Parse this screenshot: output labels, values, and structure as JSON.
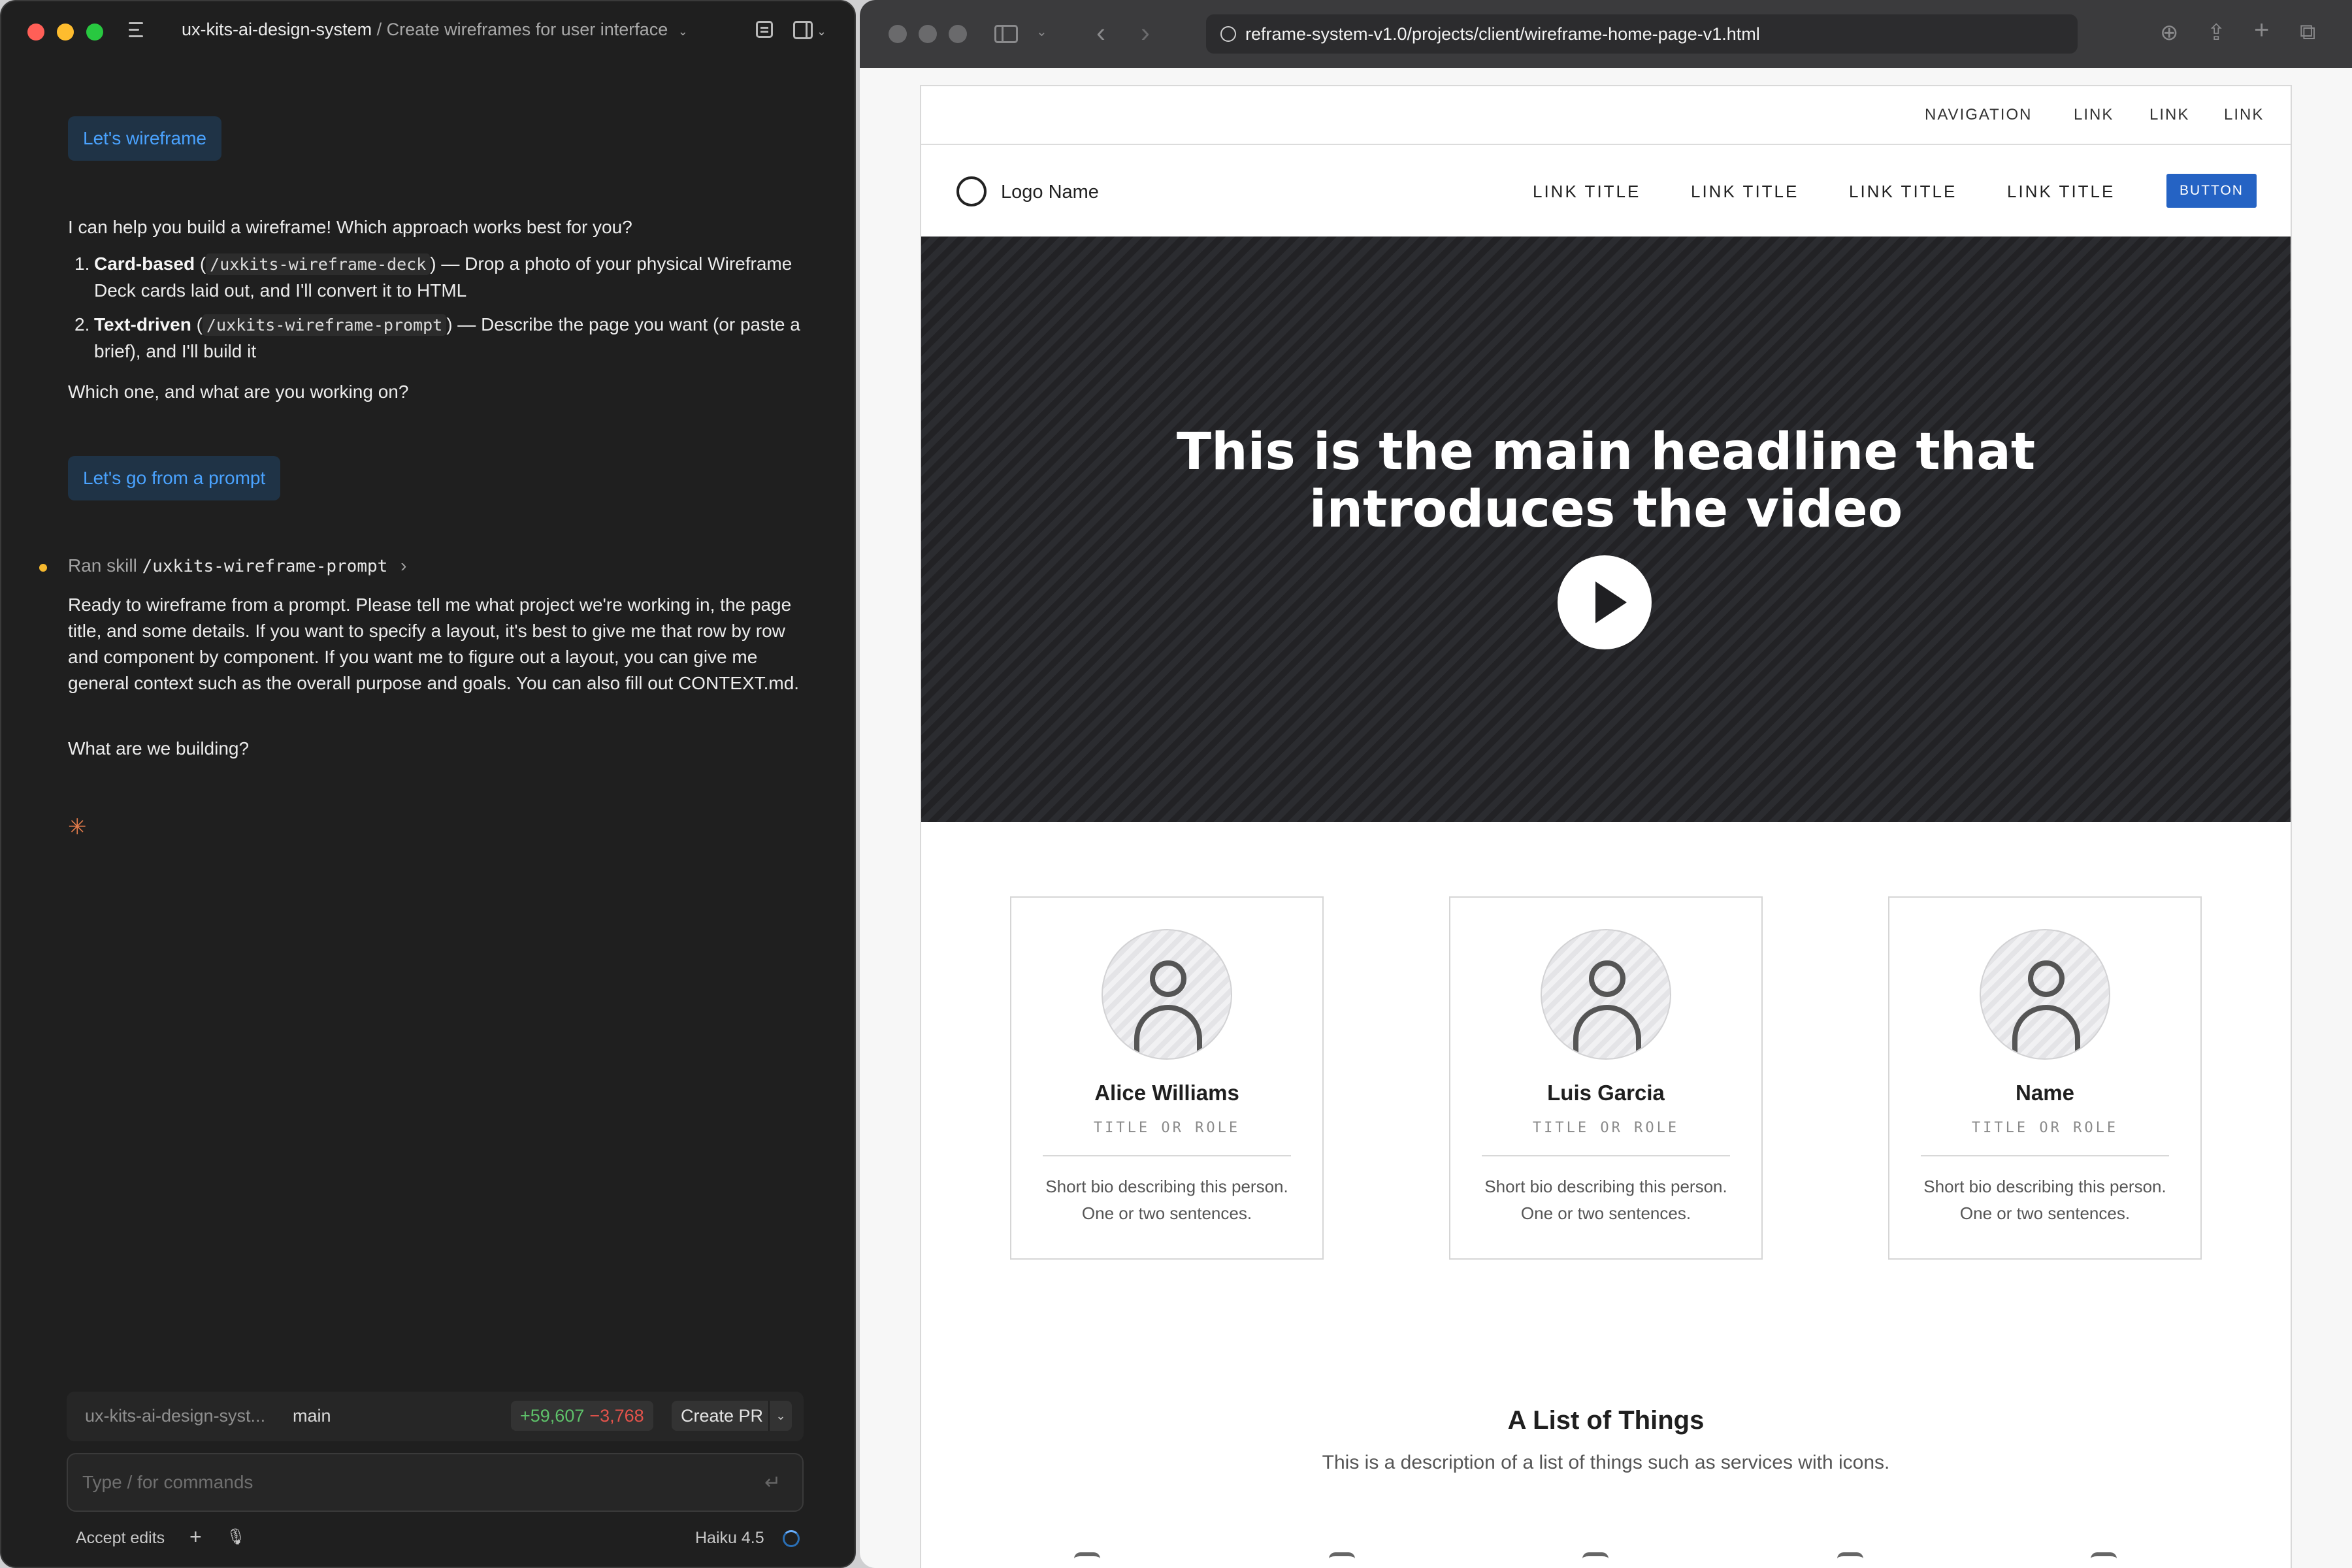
{
  "chat": {
    "project": "ux-kits-ai-design-system",
    "separator": "/",
    "conversation_title": "Create wireframes for user interface",
    "user_msg_1": "Let's wireframe",
    "assistant_intro": "I can help you build a wireframe! Which approach works best for you?",
    "options": [
      {
        "num": "1.",
        "title": "Card-based",
        "open": " (",
        "command": "/uxkits-wireframe-deck",
        "close": ")",
        "desc": " — Drop a photo of your physical Wireframe Deck cards laid out, and I'll convert it to HTML"
      },
      {
        "num": "2.",
        "title": "Text-driven",
        "open": " (",
        "command": "/uxkits-wireframe-prompt",
        "close": ")",
        "desc": " — Describe the page you want (or paste a brief), and I'll build it"
      }
    ],
    "assistant_question": "Which one, and what are you working on?",
    "user_msg_2": "Let's go from a prompt",
    "skill_prefix": "Ran skill",
    "skill_command": "/uxkits-wireframe-prompt",
    "skill_chevron": "›",
    "assistant_reply": "Ready to wireframe from a prompt. Please tell me what project we're working in, the page title, and some details. If you want to specify a layout, it's best to give me that row by row and component by component. If you want me to figure out a layout, you can give me general context such as the overall purpose and goals. You can also fill out CONTEXT.md.",
    "assistant_followup": "What are we building?",
    "thinking_glyph": "✳",
    "branch_bar": {
      "repo": "ux-kits-ai-design-syst...",
      "branch": "main",
      "additions": "+59,607",
      "deletions": "−3,768",
      "create_pr": "Create PR"
    },
    "input_placeholder": "Type / for commands",
    "footer": {
      "accept_edits": "Accept edits",
      "plus": "+",
      "mic": "🎙",
      "model": "Haiku 4.5"
    }
  },
  "browser": {
    "url": "reframe-system-v1.0/projects/client/wireframe-home-page-v1.html"
  },
  "wireframe": {
    "utility_nav": [
      "NAVIGATION",
      "LINK",
      "LINK",
      "LINK"
    ],
    "logo_name": "Logo Name",
    "nav_links": [
      "LINK TITLE",
      "LINK TITLE",
      "LINK TITLE",
      "LINK TITLE"
    ],
    "nav_button": "BUTTON",
    "hero_headline_line1": "This is the main headline that",
    "hero_headline_line2": "introduces the video",
    "people": [
      {
        "name": "Alice Williams",
        "role": "TITLE OR ROLE",
        "bio1": "Short bio describing this person.",
        "bio2": "One or two sentences."
      },
      {
        "name": "Luis Garcia",
        "role": "TITLE OR ROLE",
        "bio1": "Short bio describing this person.",
        "bio2": "One or two sentences."
      },
      {
        "name": "Name",
        "role": "TITLE OR ROLE",
        "bio1": "Short bio describing this person.",
        "bio2": "One or two sentences."
      }
    ],
    "list_title": "A List of Things",
    "list_description": "This is a description of a list of things such as services with icons."
  },
  "colors": {
    "chat_bg": "#1f1f1f",
    "chip_bg": "#1f3346",
    "chip_text": "#4aa3ff",
    "additions": "#5ec26a",
    "deletions": "#e5534b",
    "primary_button": "#2563c4"
  }
}
